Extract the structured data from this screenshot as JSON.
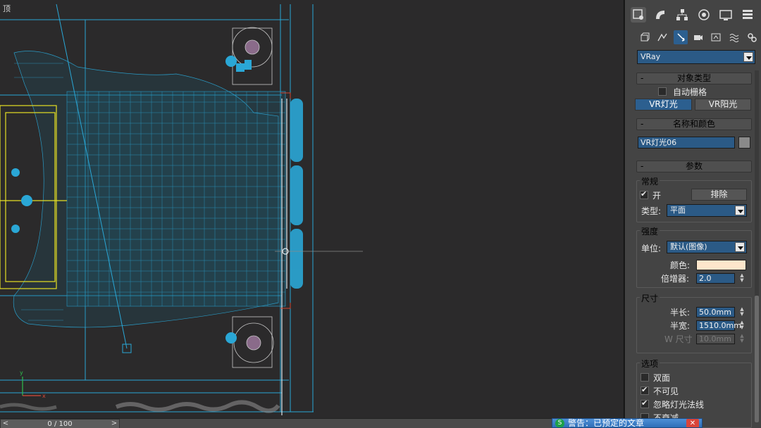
{
  "viewport": {
    "label": "顶",
    "axis_y": "y",
    "axis_x": "x"
  },
  "timeline": {
    "frame_label": "0 / 100",
    "prev": "<",
    "next": ">"
  },
  "panel": {
    "tabs": [
      "create-icon",
      "modify-icon",
      "hierarchy-icon",
      "motion-icon",
      "display-icon",
      "utilities-icon"
    ],
    "subtabs": [
      "geometry-icon",
      "shapes-icon",
      "lights-icon",
      "cameras-icon",
      "helpers-icon",
      "spacewarps-icon",
      "systems-icon"
    ],
    "renderer": "VRay",
    "object_type": {
      "title": "对象类型",
      "autogrid": "自动栅格",
      "btn_light": "VR灯光",
      "btn_sun": "VR阳光"
    },
    "name_color": {
      "title": "名称和颜色",
      "name": "VR灯光06",
      "swatch_color": "#8a8a8a"
    },
    "params": {
      "title": "参数",
      "general": {
        "title": "常规",
        "on": "开",
        "exclude": "排除",
        "type_label": "类型:",
        "type_value": "平面"
      },
      "intensity": {
        "title": "强度",
        "unit_label": "单位:",
        "unit_value": "默认(图像)",
        "color_label": "颜色:",
        "color_value": "#fde6cc",
        "multiplier_label": "倍增器:",
        "multiplier_value": "2.0"
      },
      "size": {
        "title": "尺寸",
        "half_length_label": "半长:",
        "half_length": "50.0mm",
        "half_width_label": "半宽:",
        "half_width": "1510.0mm",
        "w_size_label": "W 尺寸",
        "w_size": "10.0mm"
      },
      "options": {
        "title": "选项",
        "double_sided": "双面",
        "invisible": "不可见",
        "ignore_normals": "忽略灯光法线",
        "no_decay": "不衰减"
      }
    }
  },
  "notification": {
    "text": "警告：已预定的文章",
    "close": "✕",
    "logo": "S"
  },
  "colors": {
    "wire": "#2aa7d6",
    "yellow": "#e6e023",
    "accent": "#2c5f8f"
  }
}
